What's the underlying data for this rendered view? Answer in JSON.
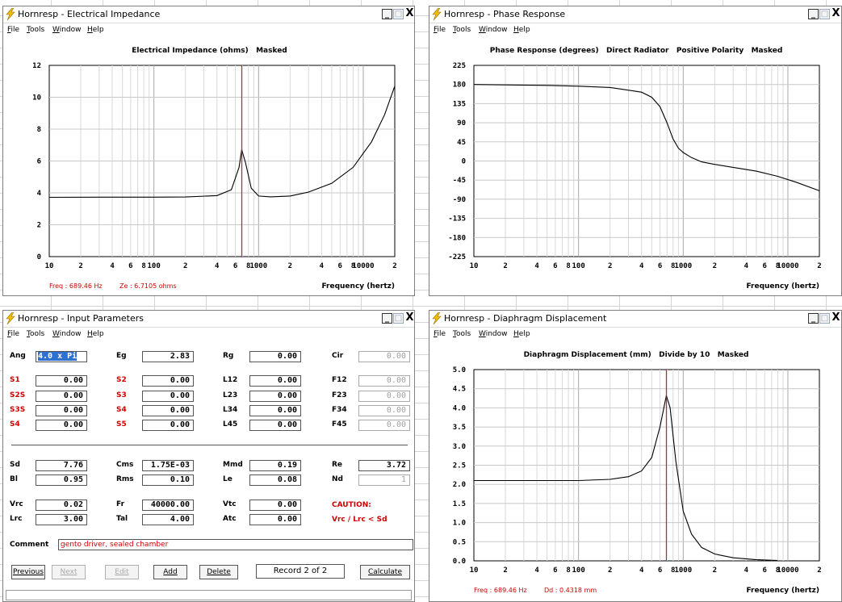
{
  "colors": {
    "accent_red": "#d00000",
    "grid": "#c8c8c8",
    "cursor": "#e00000"
  },
  "menu": [
    "File",
    "Tools",
    "Window",
    "Help"
  ],
  "window_buttons": {
    "minimize": "_",
    "maximize": "□",
    "close": "X"
  },
  "impedance": {
    "window_title": "Hornresp - Electrical Impedance",
    "chart_title": "Electrical Impedance (ohms)   Masked",
    "readout": {
      "freq": "Freq : 689.46 Hz",
      "value": "Ze : 6.7105 ohms"
    },
    "xlabel": "Frequency (hertz)"
  },
  "phase": {
    "window_title": "Hornresp - Phase Response",
    "chart_title": "Phase Response (degrees)   Direct Radiator   Positive Polarity   Masked",
    "xlabel": "Frequency (hertz)"
  },
  "displacement": {
    "window_title": "Hornresp - Diaphragm Displacement",
    "chart_title": "Diaphragm Displacement (mm)   Divide by 10   Masked",
    "readout": {
      "freq": "Freq : 689.46 Hz",
      "value": "Dd : 0.4318 mm"
    },
    "xlabel": "Frequency (hertz)"
  },
  "input": {
    "window_title": "Hornresp - Input Parameters",
    "rows": [
      [
        {
          "l": "Ang",
          "v": "4.0 x Pi",
          "sel": true
        },
        {
          "l": "Eg",
          "v": "2.83"
        },
        {
          "l": "Rg",
          "v": "0.00"
        },
        {
          "l": "Cir",
          "v": "0.00",
          "grey": true
        }
      ],
      [
        {
          "l": "S1",
          "v": "0.00",
          "red": true
        },
        {
          "l": "S2",
          "v": "0.00",
          "red": true
        },
        {
          "l": "L12",
          "v": "0.00"
        },
        {
          "l": "F12",
          "v": "0.00",
          "grey": true
        }
      ],
      [
        {
          "l": "S2S",
          "v": "0.00",
          "red": true
        },
        {
          "l": "S3",
          "v": "0.00",
          "red": true
        },
        {
          "l": "L23",
          "v": "0.00"
        },
        {
          "l": "F23",
          "v": "0.00",
          "grey": true
        }
      ],
      [
        {
          "l": "S3S",
          "v": "0.00",
          "red": true
        },
        {
          "l": "S4",
          "v": "0.00",
          "red": true
        },
        {
          "l": "L34",
          "v": "0.00"
        },
        {
          "l": "F34",
          "v": "0.00",
          "grey": true
        }
      ],
      [
        {
          "l": "S4",
          "v": "0.00",
          "red": true
        },
        {
          "l": "S5",
          "v": "0.00",
          "red": true
        },
        {
          "l": "L45",
          "v": "0.00"
        },
        {
          "l": "F45",
          "v": "0.00",
          "grey": true
        }
      ]
    ],
    "rows2": [
      [
        {
          "l": "Sd",
          "v": "7.76"
        },
        {
          "l": "Cms",
          "v": "1.75E-03"
        },
        {
          "l": "Mmd",
          "v": "0.19"
        },
        {
          "l": "Re",
          "v": "3.72"
        }
      ],
      [
        {
          "l": "Bl",
          "v": "0.95"
        },
        {
          "l": "Rms",
          "v": "0.10"
        },
        {
          "l": "Le",
          "v": "0.08"
        },
        {
          "l": "Nd",
          "v": "1",
          "grey": true
        }
      ]
    ],
    "rows3": [
      [
        {
          "l": "Vrc",
          "v": "0.02"
        },
        {
          "l": "Fr",
          "v": "40000.00"
        },
        {
          "l": "Vtc",
          "v": "0.00"
        }
      ],
      [
        {
          "l": "Lrc",
          "v": "3.00"
        },
        {
          "l": "Tal",
          "v": "4.00"
        },
        {
          "l": "Atc",
          "v": "0.00"
        }
      ]
    ],
    "caution": "CAUTION:",
    "caution_note": "Vrc / Lrc < Sd",
    "comment_label": "Comment",
    "comment": "gento driver, sealed chamber",
    "buttons": {
      "previous": "Previous",
      "next": "Next",
      "edit": "Edit",
      "add": "Add",
      "delete": "Delete",
      "calculate": "Calculate"
    },
    "record": "Record 2 of 2"
  },
  "chart_data": [
    {
      "type": "line",
      "title": "Electrical Impedance (ohms)   Masked",
      "xlabel": "Frequency (hertz)",
      "x_scale": "log",
      "xlim": [
        10,
        20000
      ],
      "ylim": [
        0,
        12
      ],
      "yticks": [
        0,
        2,
        4,
        6,
        8,
        10,
        12
      ],
      "xtick_labels": [
        "10",
        "2",
        "4",
        "6",
        "8",
        "100",
        "2",
        "4",
        "6",
        "8",
        "1000",
        "2",
        "4",
        "6",
        "8",
        "10000",
        "2"
      ],
      "cursor_x": 689.46,
      "series": [
        {
          "x": [
            10,
            50,
            100,
            200,
            400,
            550,
            650,
            689.46,
            750,
            850,
            1000,
            1300,
            2000,
            3000,
            5000,
            8000,
            12000,
            16000,
            20000
          ],
          "y": [
            3.72,
            3.73,
            3.73,
            3.74,
            3.83,
            4.2,
            5.6,
            6.71,
            5.9,
            4.3,
            3.8,
            3.75,
            3.8,
            4.05,
            4.6,
            5.6,
            7.2,
            8.9,
            10.7
          ]
        }
      ]
    },
    {
      "type": "line",
      "title": "Phase Response (degrees)   Direct Radiator   Positive Polarity   Masked",
      "xlabel": "Frequency (hertz)",
      "x_scale": "log",
      "xlim": [
        10,
        20000
      ],
      "ylim": [
        -225,
        225
      ],
      "yticks": [
        -225,
        -180,
        -135,
        -90,
        -45,
        0,
        45,
        90,
        135,
        180,
        225
      ],
      "xtick_labels": [
        "10",
        "2",
        "4",
        "6",
        "8",
        "100",
        "2",
        "4",
        "6",
        "8",
        "1000",
        "2",
        "4",
        "6",
        "8",
        "10000",
        "2"
      ],
      "series": [
        {
          "x": [
            10,
            50,
            100,
            200,
            400,
            500,
            600,
            700,
            800,
            900,
            1000,
            1200,
            1500,
            2000,
            3000,
            5000,
            8000,
            12000,
            20000
          ],
          "y": [
            180,
            178,
            176,
            173,
            162,
            150,
            128,
            90,
            52,
            30,
            20,
            8,
            -2,
            -8,
            -15,
            -24,
            -36,
            -50,
            -70
          ]
        }
      ]
    },
    {
      "type": "line",
      "title": "Diaphragm Displacement (mm)   Divide by 10   Masked",
      "xlabel": "Frequency (hertz)",
      "x_scale": "log",
      "xlim": [
        10,
        20000
      ],
      "ylim": [
        0,
        5
      ],
      "yticks": [
        0.0,
        0.5,
        1.0,
        1.5,
        2.0,
        2.5,
        3.0,
        3.5,
        4.0,
        4.5,
        5.0
      ],
      "xtick_labels": [
        "10",
        "2",
        "4",
        "6",
        "8",
        "100",
        "2",
        "4",
        "6",
        "8",
        "1000",
        "2",
        "4",
        "6",
        "8",
        "10000",
        "2"
      ],
      "cursor_x": 689.46,
      "series": [
        {
          "x": [
            10,
            50,
            100,
            200,
            300,
            400,
            500,
            600,
            689.46,
            750,
            850,
            1000,
            1200,
            1500,
            2000,
            3000,
            5000,
            8000
          ],
          "y": [
            2.1,
            2.1,
            2.1,
            2.13,
            2.2,
            2.35,
            2.7,
            3.5,
            4.32,
            4.0,
            2.6,
            1.3,
            0.7,
            0.35,
            0.18,
            0.08,
            0.03,
            0.01
          ]
        }
      ]
    }
  ]
}
